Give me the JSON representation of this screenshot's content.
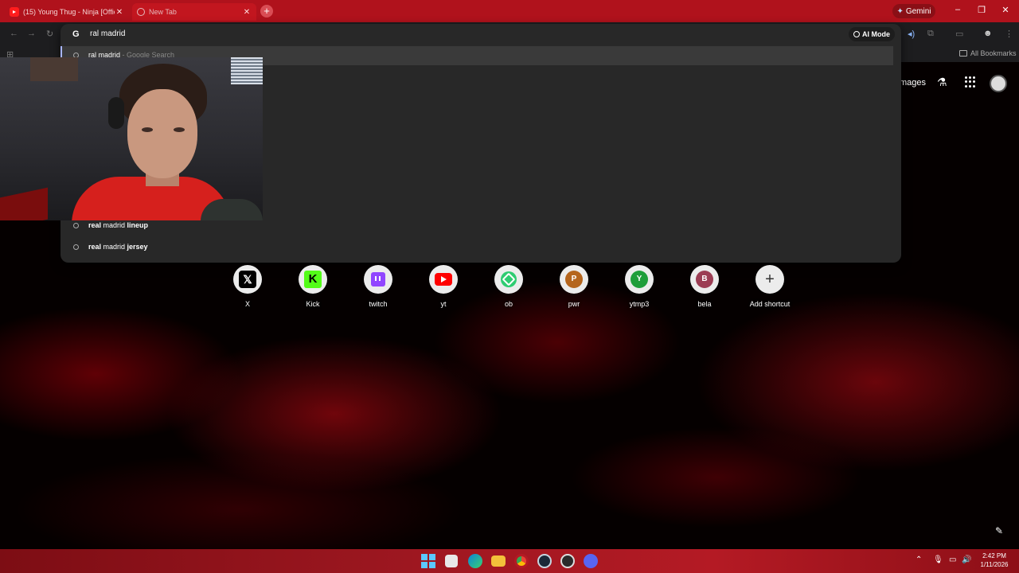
{
  "tabs": [
    {
      "title": "(15) Young Thug - Ninja [Offici",
      "active": false
    },
    {
      "title": "New Tab",
      "active": true
    }
  ],
  "gemini_label": "Gemini",
  "window_controls": {
    "minimize": "–",
    "restore": "❐",
    "close": "✕"
  },
  "bookmarks": {
    "all_label": "All Bookmarks"
  },
  "omnibox": {
    "input_value": "ral madrid",
    "ai_mode_label": "AI Mode",
    "suggestions": [
      {
        "bold": "",
        "normal": "ral madrid",
        "suffix": " - Google Search"
      },
      {
        "bold": "real",
        "normal": " madrid ",
        "bold2": "lineup"
      },
      {
        "bold": "real",
        "normal": " madrid ",
        "bold2": "jersey"
      }
    ]
  },
  "ntp": {
    "images_label": "mages",
    "shortcuts": [
      {
        "label": "X",
        "icon": "x-logo-icon"
      },
      {
        "label": "Kick",
        "icon": "kick-logo-icon",
        "glyph": "K"
      },
      {
        "label": "twitch",
        "icon": "twitch-logo-icon"
      },
      {
        "label": "yt",
        "icon": "youtube-logo-icon"
      },
      {
        "label": "ob",
        "icon": "ob-logo-icon"
      },
      {
        "label": "pwr",
        "icon": "letter-p-icon",
        "glyph": "P",
        "color": "#b5651d"
      },
      {
        "label": "ytmp3",
        "icon": "letter-y-icon",
        "glyph": "Y",
        "color": "#1e9e3a"
      },
      {
        "label": "bela",
        "icon": "letter-b-icon",
        "glyph": "B",
        "color": "#9c3d54"
      },
      {
        "label": "Add shortcut",
        "icon": "plus-icon",
        "glyph": "+"
      }
    ]
  },
  "taskbar": {
    "time": "2:42 PM",
    "date": "1/11/2026"
  }
}
